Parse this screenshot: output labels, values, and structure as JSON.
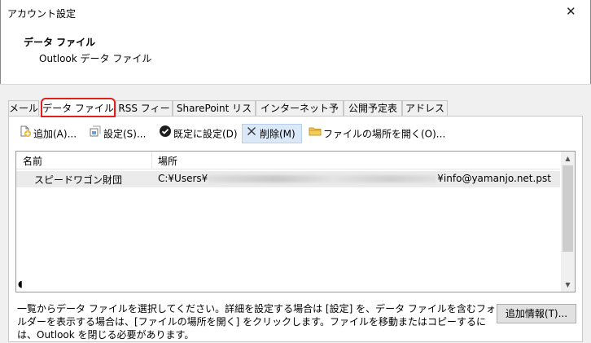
{
  "window": {
    "title": "アカウント設定",
    "close_glyph": "✕"
  },
  "header": {
    "title": "データ ファイル",
    "subtitle": "Outlook データ ファイル"
  },
  "tabs": [
    {
      "label": "メール"
    },
    {
      "label": "データ ファイル",
      "selected": true
    },
    {
      "label": "RSS フィード"
    },
    {
      "label": "SharePoint リスト"
    },
    {
      "label": "インターネット予定表"
    },
    {
      "label": "公開予定表"
    },
    {
      "label": "アドレス帳"
    }
  ],
  "toolbar": {
    "add": {
      "label": "追加(A)...",
      "icon": "add-file-icon"
    },
    "settings": {
      "label": "設定(S)...",
      "icon": "settings-file-icon"
    },
    "default": {
      "label": "既定に設定(D)",
      "icon": "check-circle-icon"
    },
    "delete": {
      "label": "削除(M)",
      "icon": "x-delete-icon"
    },
    "open_location": {
      "label": "ファイルの場所を開く(O)...",
      "icon": "folder-icon"
    }
  },
  "list": {
    "columns": {
      "name": "名前",
      "location": "場所"
    },
    "rows": [
      {
        "name": "スピードワゴン財団",
        "location_prefix": "C:¥Users¥",
        "location_suffix": "¥info@yamanjo.net.pst"
      }
    ]
  },
  "footer": {
    "description": "一覧からデータ ファイルを選択してください。詳細を設定する場合は [設定] を、データ ファイルを含むフォルダーを表示する場合は、[ファイルの場所を開く] をクリックします。ファイルを移動またはコピーするには、Outlook を閉じる必要があります。",
    "more_info_label": "追加情報(T)..."
  },
  "colors": {
    "tab_highlight": "#e0201a",
    "selected_row": "#ebebeb",
    "hover_button": "#dbe8f7"
  }
}
